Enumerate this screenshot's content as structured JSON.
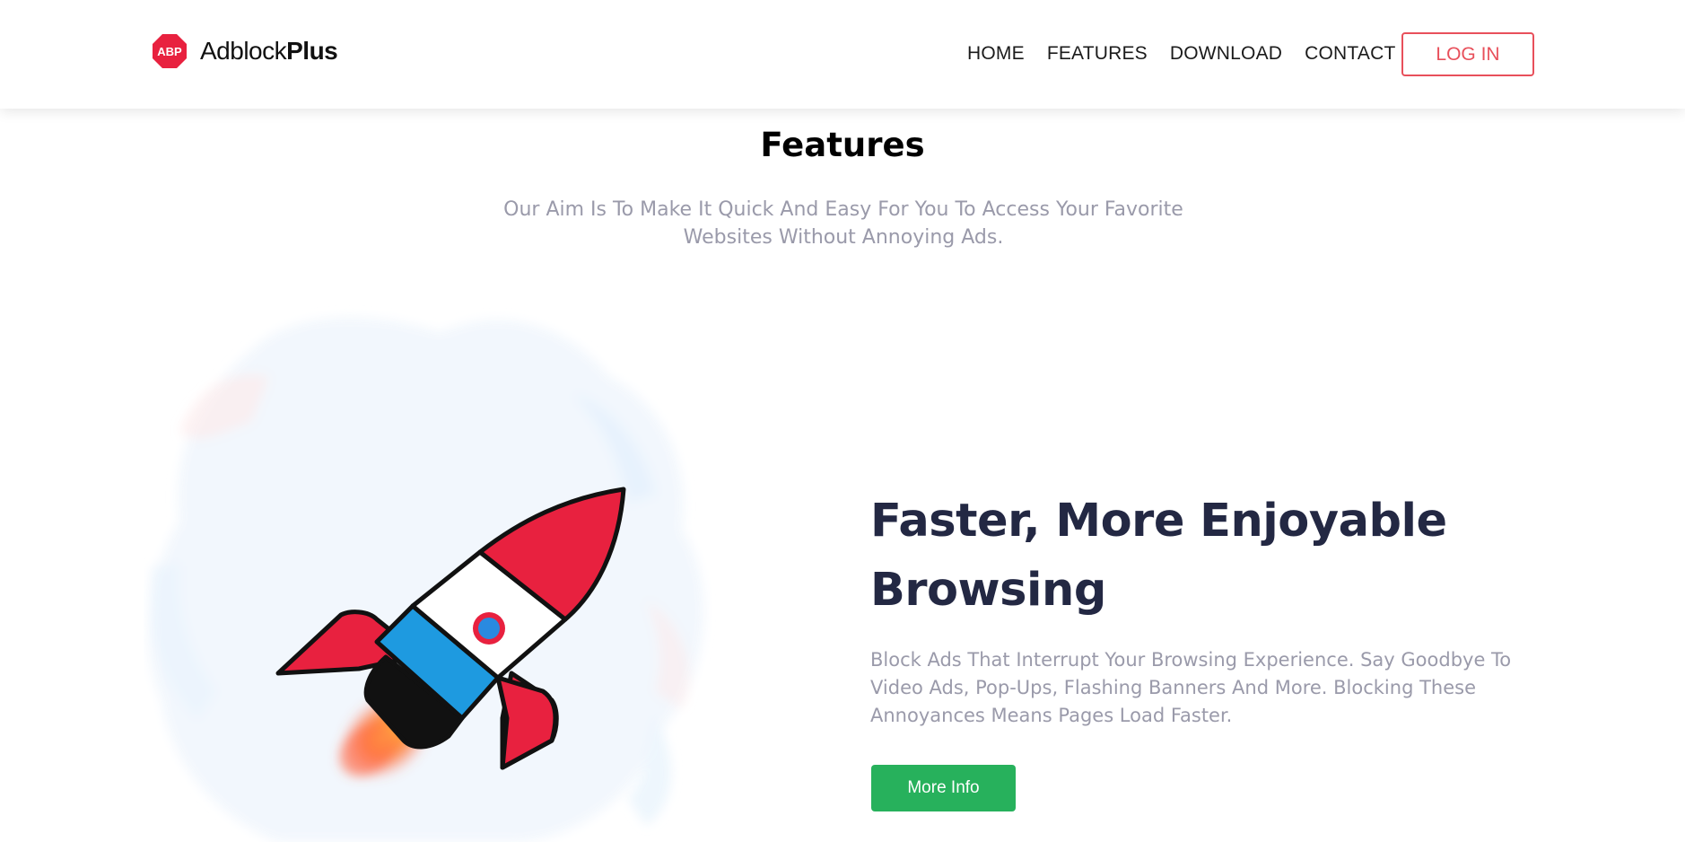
{
  "header": {
    "logo_badge": "ABP",
    "logo_light": "Adblock",
    "logo_bold": "Plus",
    "nav": [
      {
        "label": "HOME"
      },
      {
        "label": "FEATURES"
      },
      {
        "label": "DOWNLOAD"
      },
      {
        "label": "CONTACT"
      }
    ],
    "login_label": "LOG IN"
  },
  "features": {
    "title": "Features",
    "subtitle": "Our Aim Is To Make It Quick And Easy For You To Access Your Favorite Websites Without Annoying Ads."
  },
  "feature": {
    "heading": "Faster, More Enjoyable Browsing",
    "description": "Block Ads That Interrupt Your Browsing Experience. Say Goodbye To Video Ads, Pop-Ups, Flashing Banners And More. Blocking These Annoyances Means Pages Load Faster.",
    "button_label": "More Info",
    "illustration_icon": "rocket-icon"
  },
  "colors": {
    "brand_red": "#e8213f",
    "login_border": "#e8505b",
    "button_green": "#27b15c",
    "heading_navy": "#232843",
    "muted_text": "#9a9aaa",
    "rocket_blue": "#1e9ae0"
  }
}
